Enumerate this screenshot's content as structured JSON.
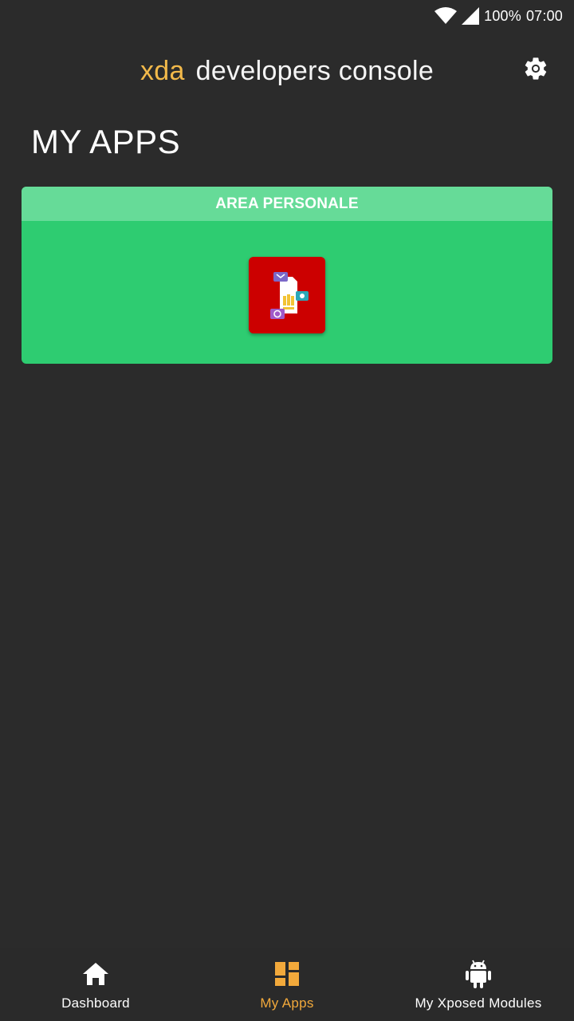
{
  "status_bar": {
    "battery": "100%",
    "time": "07:00",
    "icons": [
      "wifi-icon",
      "signal-icon"
    ]
  },
  "app_bar": {
    "brand": "xda",
    "title": "developers console",
    "settings_icon": "gear-icon"
  },
  "section": {
    "title": "MY APPS"
  },
  "apps": [
    {
      "name": "AREA PERSONALE",
      "icon": "sim-card-app-icon",
      "icon_bg": "#cc0000"
    }
  ],
  "bottom_nav": {
    "items": [
      {
        "label": "Dashboard",
        "icon": "home-icon",
        "active": false
      },
      {
        "label": "My Apps",
        "icon": "dashboard-grid-icon",
        "active": true
      },
      {
        "label": "My Xposed Modules",
        "icon": "android-icon",
        "active": false
      }
    ]
  },
  "colors": {
    "background": "#2b2b2b",
    "accent": "#f2a93b",
    "brand": "#f2b94a",
    "card": "#2ecc71",
    "card_header": "#66db98"
  }
}
